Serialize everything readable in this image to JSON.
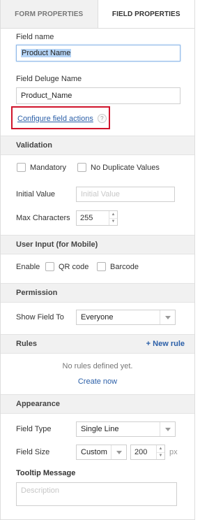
{
  "tabs": {
    "form_properties": "FORM PROPERTIES",
    "field_properties": "FIELD PROPERTIES"
  },
  "field_name": {
    "label": "Field name",
    "value": "Product Name"
  },
  "deluge_name": {
    "label": "Field Deluge Name",
    "value": "Product_Name"
  },
  "configure_actions": {
    "label": "Configure field actions",
    "help": "?"
  },
  "validation": {
    "header": "Validation",
    "mandatory": "Mandatory",
    "no_duplicates": "No Duplicate Values",
    "initial_value_label": "Initial Value",
    "initial_value_placeholder": "Initial Value",
    "max_chars_label": "Max Characters",
    "max_chars_value": "255"
  },
  "user_input": {
    "header": "User Input (for Mobile)",
    "enable_label": "Enable",
    "qr_code": "QR code",
    "barcode": "Barcode"
  },
  "permission": {
    "header": "Permission",
    "show_field_to_label": "Show Field To",
    "show_field_to_value": "Everyone"
  },
  "rules": {
    "header": "Rules",
    "new_rule": "+ New rule",
    "empty_text": "No rules defined yet.",
    "create_now": "Create now"
  },
  "appearance": {
    "header": "Appearance",
    "field_type_label": "Field Type",
    "field_type_value": "Single Line",
    "field_size_label": "Field Size",
    "field_size_value": "Custom",
    "field_size_number": "200",
    "field_size_unit": "px",
    "tooltip_label": "Tooltip Message",
    "tooltip_placeholder": "Description"
  },
  "icons": {
    "stepper_up": "▲",
    "stepper_down": "▼"
  },
  "colors": {
    "highlight": "#d0142c",
    "link": "#2b5fa8",
    "selection": "#b6d5f7"
  }
}
